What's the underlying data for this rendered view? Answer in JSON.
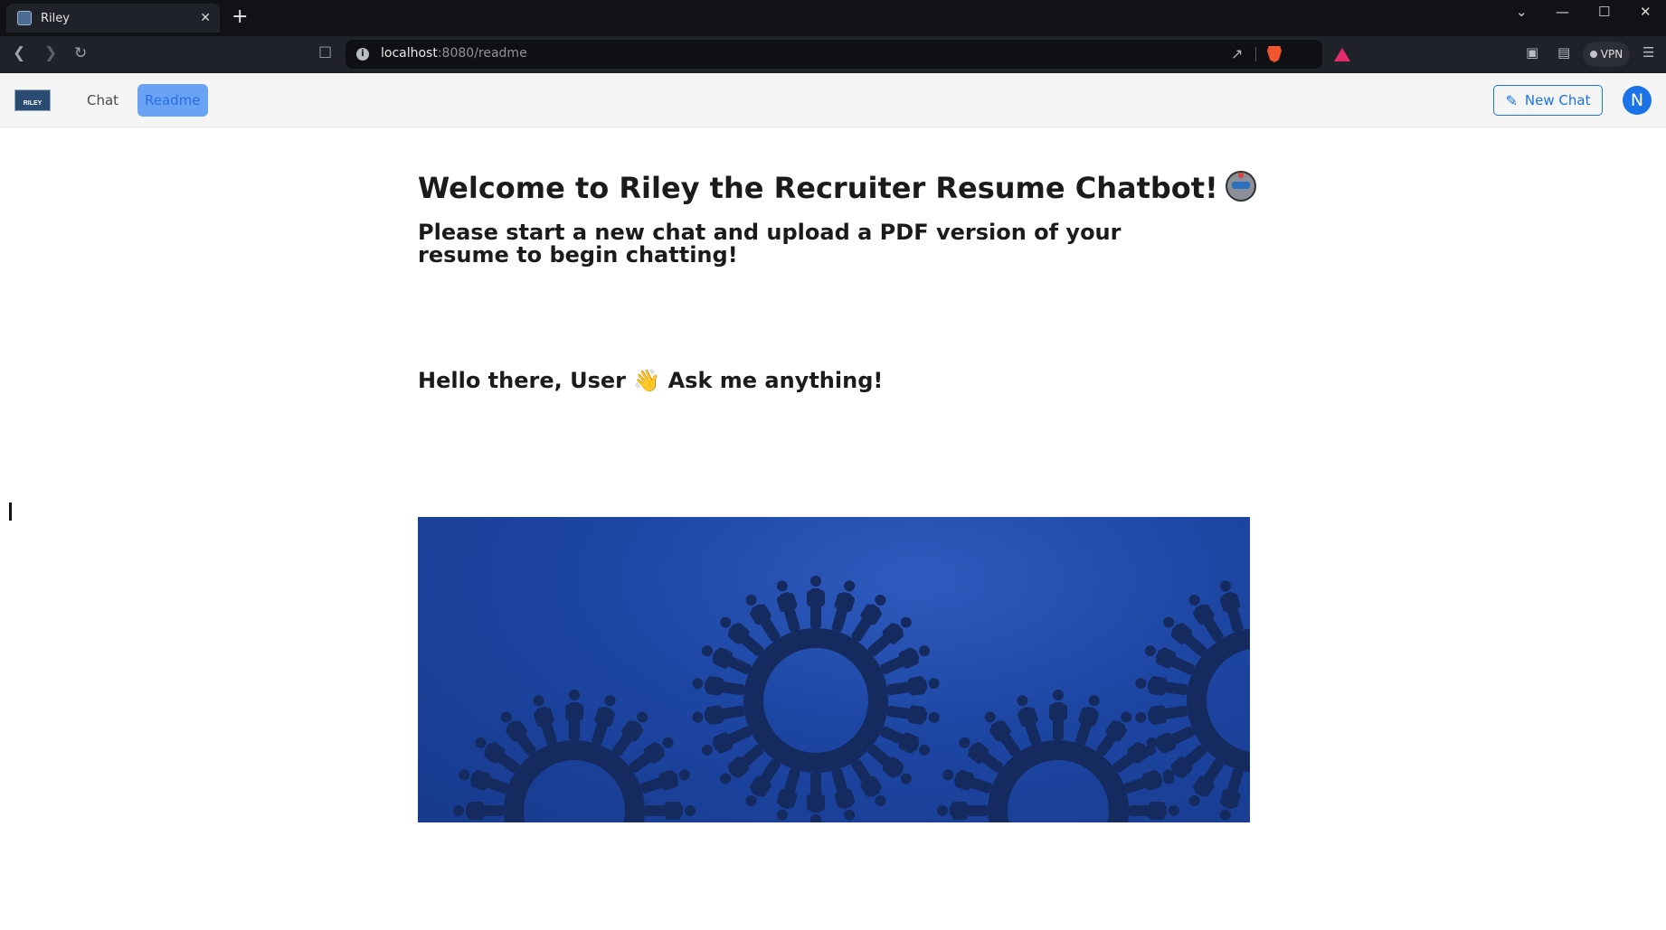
{
  "browser": {
    "tab_title": "Riley",
    "tab_close": "✕",
    "new_tab": "+",
    "url_host": "localhost",
    "url_rest": ":8080/readme",
    "vpn_label": "VPN",
    "window_controls": [
      "⌄",
      "—",
      "☐",
      "✕"
    ]
  },
  "header": {
    "logo_text": "RILEY",
    "nav": [
      "Chat",
      "Readme"
    ],
    "active_nav": "Readme",
    "new_chat_label": "New Chat",
    "avatar_initial": "N"
  },
  "main": {
    "title": "Welcome to Riley the Recruiter Resume Chatbot!",
    "subtitle": "Please start a new chat and upload a PDF version of your resume to begin chatting!",
    "greeting_before": "Hello there, User",
    "greeting_emoji": "👋",
    "greeting_after": "Ask me anything!"
  },
  "colors": {
    "accent": "#1a73e8",
    "nav_active_bg": "#6aa3f5",
    "banner_dark": "#173a8c",
    "banner_figures": "#152a5e"
  }
}
